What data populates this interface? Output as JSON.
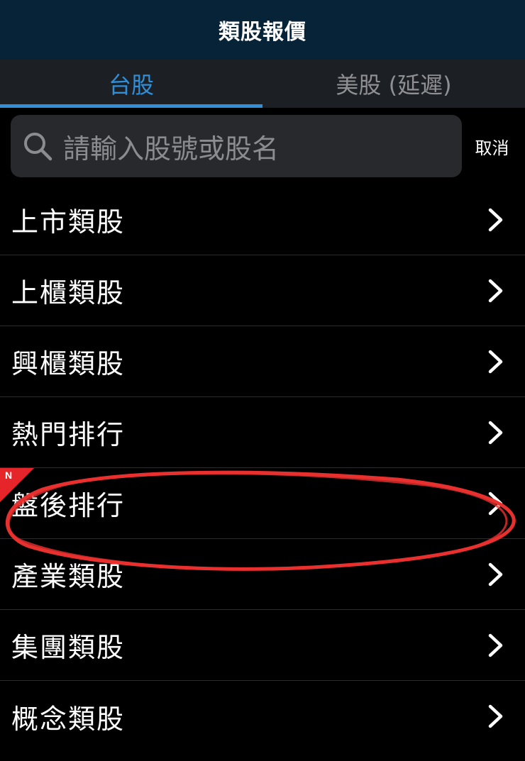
{
  "header": {
    "title": "類股報價"
  },
  "tabs": [
    {
      "label": "台股",
      "active": true
    },
    {
      "label": "美股 (延遲)",
      "active": false
    }
  ],
  "search": {
    "placeholder": "請輸入股號或股名",
    "cancel_label": "取消"
  },
  "list": {
    "items": [
      {
        "label": "上市類股"
      },
      {
        "label": "上櫃類股"
      },
      {
        "label": "興櫃類股"
      },
      {
        "label": "熱門排行"
      },
      {
        "label": "盤後排行",
        "badge": "N"
      },
      {
        "label": "產業類股"
      },
      {
        "label": "集團類股"
      },
      {
        "label": "概念類股"
      }
    ]
  },
  "colors": {
    "header_bg": "#062338",
    "accent": "#2f8fd8",
    "badge": "#e6252b",
    "annotation": "#e8312f"
  },
  "icons": {
    "search": "search-icon",
    "chevron": "chevron-right-icon"
  }
}
